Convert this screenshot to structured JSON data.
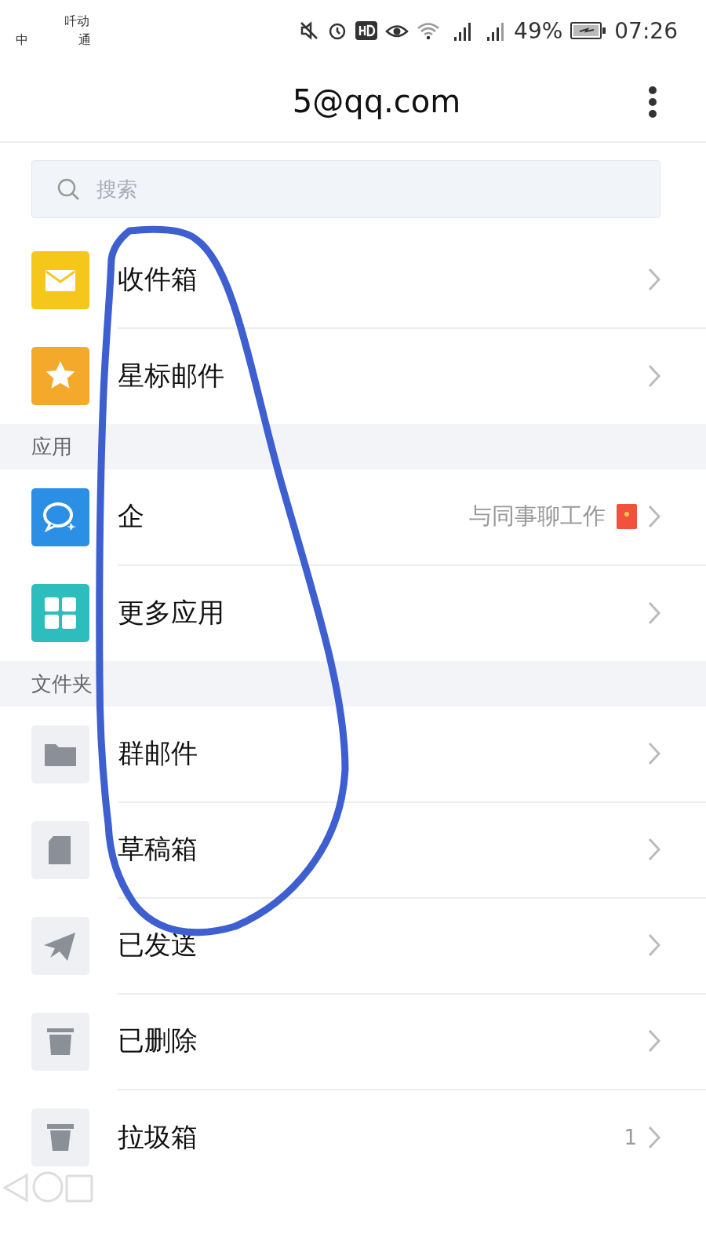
{
  "status_bar": {
    "carrier": [
      "吀动",
      "中",
      "通"
    ],
    "battery": "49%",
    "time": "07:26"
  },
  "header": {
    "title": "5@qq.com"
  },
  "search": {
    "placeholder": "搜索"
  },
  "sections": [
    {
      "items": [
        {
          "kind": "inbox",
          "label": "收件箱"
        },
        {
          "kind": "star",
          "label": "星标邮件"
        }
      ]
    },
    {
      "title": "应用",
      "items": [
        {
          "kind": "chat",
          "label": "企",
          "note": "与同事聊工作",
          "envelope": true
        },
        {
          "kind": "apps",
          "label": "更多应用"
        }
      ]
    },
    {
      "title": "文件夹",
      "items": [
        {
          "kind": "folder",
          "label": "群邮件"
        },
        {
          "kind": "draft",
          "label": "草稿箱"
        },
        {
          "kind": "sent",
          "label": "已发送"
        },
        {
          "kind": "trash",
          "label": "已删除"
        },
        {
          "kind": "junk",
          "label": "拉圾箱",
          "count": "1"
        }
      ]
    }
  ]
}
